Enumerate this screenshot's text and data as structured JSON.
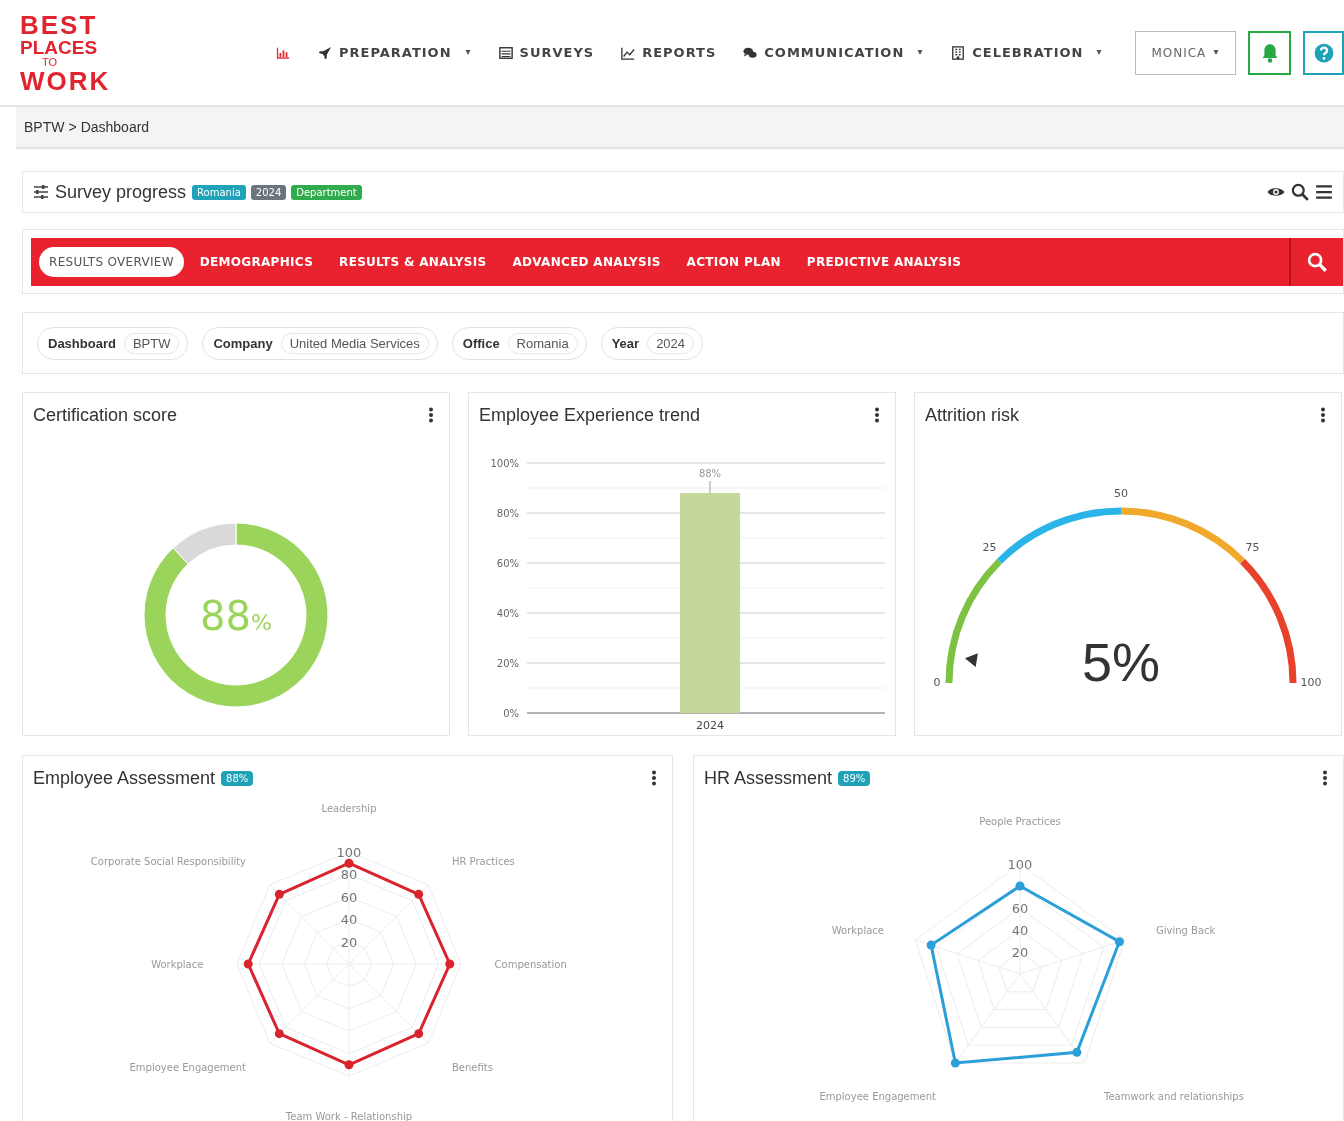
{
  "logo": {
    "lines": [
      "BEST",
      "PLACES",
      "TO",
      "WORK"
    ]
  },
  "nav": [
    {
      "dropdown": false
    },
    {
      "label": "PREPARATION",
      "dropdown": true
    },
    {
      "label": "SURVEYS",
      "dropdown": false
    },
    {
      "label": "REPORTS",
      "dropdown": false
    },
    {
      "label": "COMMUNICATION",
      "dropdown": true
    },
    {
      "label": "CELEBRATION",
      "dropdown": true
    }
  ],
  "user_menu": {
    "label": "MONICA",
    "dropdown": true
  },
  "breadcrumb": {
    "items": [
      "BPTW",
      "Dashboard"
    ],
    "separator": ">"
  },
  "survey_panel": {
    "title": "Survey progress",
    "tags": [
      {
        "label": "Romania",
        "color": "#20a3b9"
      },
      {
        "label": "2024",
        "color": "#6c757d"
      },
      {
        "label": "Department",
        "color": "#2eab4c"
      }
    ]
  },
  "tabs": [
    {
      "label": "RESULTS OVERVIEW",
      "selected": true
    },
    {
      "label": "DEMOGRAPHICS",
      "selected": false
    },
    {
      "label": "RESULTS & ANALYSIS",
      "selected": false
    },
    {
      "label": "ADVANCED ANALYSIS",
      "selected": false
    },
    {
      "label": "ACTION PLAN",
      "selected": false
    },
    {
      "label": "PREDICTIVE ANALYSIS",
      "selected": false
    }
  ],
  "filters": [
    {
      "label": "Dashboard",
      "value": "BPTW"
    },
    {
      "label": "Company",
      "value": "United Media Services"
    },
    {
      "label": "Office",
      "value": "Romania"
    },
    {
      "label": "Year",
      "value": "2024"
    }
  ],
  "certification": {
    "title": "Certification score",
    "reading": "88",
    "unit": "%",
    "chart_data": {
      "type": "donut",
      "series": [
        {
          "values": [
            88,
            12
          ]
        }
      ]
    }
  },
  "trend": {
    "title": "Employee Experience trend",
    "chart_data": {
      "type": "bar",
      "categories": [
        "2024"
      ],
      "series": [
        {
          "color": "#c3d89a",
          "values": [
            88
          ]
        }
      ],
      "ylim": [
        0,
        100
      ],
      "grid": true,
      "yticks": [
        {
          "value": 0,
          "label": "0%"
        },
        {
          "value": 20,
          "label": "20%"
        },
        {
          "value": 40,
          "label": "40%"
        },
        {
          "value": 60,
          "label": "60%"
        },
        {
          "value": 80,
          "label": "80%"
        },
        {
          "value": 100,
          "label": "100%"
        }
      ],
      "value_labels": [
        "88%"
      ]
    }
  },
  "attrition": {
    "title": "Attrition risk",
    "level": 0.05,
    "reading": "5%",
    "scale": [
      "0",
      "25",
      "50",
      "75",
      "100"
    ]
  },
  "employee_assessment": {
    "title": "Employee Assessment",
    "badge": "88%",
    "chart_data": {
      "type": "radar",
      "categories": [
        "Leadership",
        "HR Practices",
        "Compensation",
        "Benefits",
        "Team Work - Relationship",
        "Employee Engagement",
        "Workplace",
        "Corporate Social Responsibility"
      ],
      "series": [
        {
          "color": "#d9232d",
          "values": [
            90,
            88,
            90,
            88,
            90,
            88,
            90,
            88
          ]
        }
      ],
      "ylim": [
        0,
        100
      ],
      "yticks": [
        20,
        40,
        60,
        80,
        100
      ]
    }
  },
  "hr_assessment": {
    "title": "HR Assessment",
    "badge": "89%",
    "chart_data": {
      "type": "radar",
      "categories": [
        "People Practices",
        "Giving Back",
        "Teamwork and relationships",
        "Employee Engagement",
        "Workplace"
      ],
      "series": [
        {
          "color": "#2a9fd8",
          "values": [
            80,
            95,
            88,
            100,
            85
          ]
        }
      ],
      "ylim": [
        0,
        100
      ],
      "yticks": [
        20,
        40,
        60,
        100
      ]
    }
  }
}
